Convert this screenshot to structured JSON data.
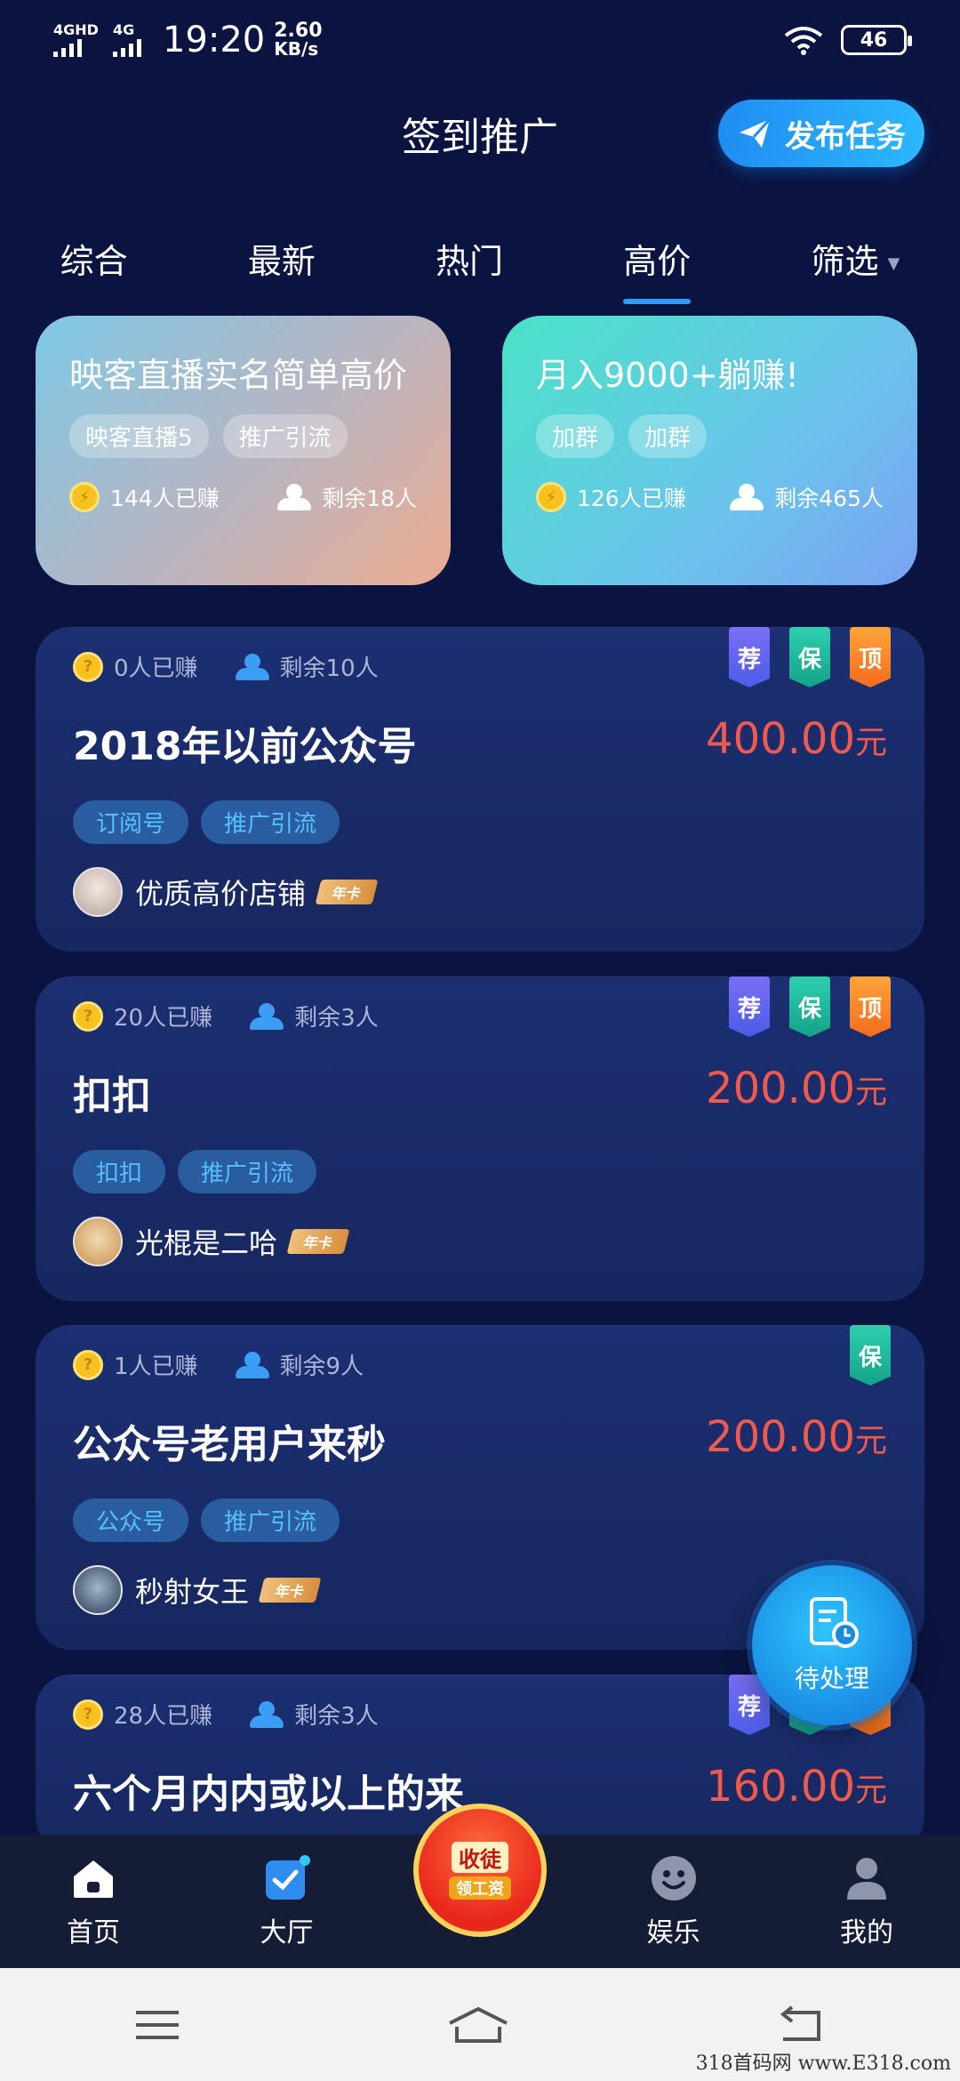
{
  "status_bar": {
    "sim1": "4GHD",
    "sim2": "4G",
    "time": "19:20",
    "speed_value": "2.60",
    "speed_unit": "KB/s",
    "battery": "46"
  },
  "header": {
    "title": "签到推广",
    "publish_label": "发布任务"
  },
  "tabs": [
    {
      "label": "综合",
      "active": false
    },
    {
      "label": "最新",
      "active": false
    },
    {
      "label": "热门",
      "active": false
    },
    {
      "label": "高价",
      "active": true
    },
    {
      "label": "筛选",
      "active": false
    }
  ],
  "featured": [
    {
      "title": "映客直播实名简单高价",
      "tags": [
        "映客直播5",
        "推广引流"
      ],
      "earned": "144人已赚",
      "remaining": "剩余18人"
    },
    {
      "title": "月入9000+躺赚!",
      "tags": [
        "加群",
        "加群"
      ],
      "earned": "126人已赚",
      "remaining": "剩余465人"
    }
  ],
  "tasks": [
    {
      "earned": "0人已赚",
      "remaining": "剩余10人",
      "title": "2018年以前公众号",
      "price": "400.00",
      "unit": "元",
      "tags": [
        "订阅号",
        "推广引流"
      ],
      "user": "优质高价店铺",
      "vip": "年卡",
      "badges": [
        "荐",
        "保",
        "顶"
      ]
    },
    {
      "earned": "20人已赚",
      "remaining": "剩余3人",
      "title": "扣扣",
      "price": "200.00",
      "unit": "元",
      "tags": [
        "扣扣",
        "推广引流"
      ],
      "user": "光棍是二哈",
      "vip": "年卡",
      "badges": [
        "荐",
        "保",
        "顶"
      ]
    },
    {
      "earned": "1人已赚",
      "remaining": "剩余9人",
      "title": "公众号老用户来秒",
      "price": "200.00",
      "unit": "元",
      "tags": [
        "公众号",
        "推广引流"
      ],
      "user": "秒射女王",
      "vip": "年卡",
      "badges": [
        "保"
      ]
    },
    {
      "earned": "28人已赚",
      "remaining": "剩余3人",
      "title": "六个月内内或以上的来",
      "price": "160.00",
      "unit": "元",
      "badges": [
        "荐"
      ]
    }
  ],
  "float_button": {
    "label": "待处理"
  },
  "bottom_nav": {
    "home": "首页",
    "hall": "大厅",
    "promo_line1": "收徒",
    "promo_line2": "领工资",
    "fun": "娱乐",
    "mine": "我的"
  },
  "watermark": "318首码网 www.E318.com",
  "colors": {
    "background": "#0b1340",
    "accent": "#2d9cff",
    "price": "#ef5a4c",
    "tag_text": "#56c0ff"
  }
}
